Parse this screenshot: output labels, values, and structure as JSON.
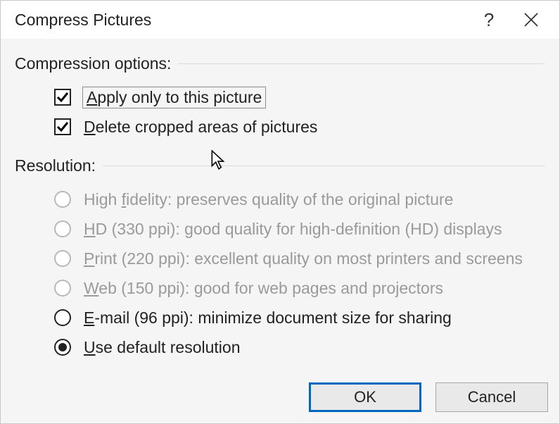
{
  "title": "Compress Pictures",
  "groups": {
    "compression": {
      "header": "Compression options:",
      "apply_only": {
        "label_pre": "",
        "accel": "A",
        "label_post": "pply only to this picture",
        "checked": true,
        "focused": true
      },
      "delete_cropped": {
        "accel": "D",
        "label_post": "elete cropped areas of pictures",
        "checked": true
      }
    },
    "resolution": {
      "header": "Resolution:",
      "options": [
        {
          "accel": "f",
          "pre": "High ",
          "post": "idelity: preserves quality of the original picture",
          "enabled": false,
          "selected": false
        },
        {
          "accel": "H",
          "pre": "",
          "post": "D (330 ppi): good quality for high-definition (HD) displays",
          "enabled": false,
          "selected": false
        },
        {
          "accel": "P",
          "pre": "",
          "post": "rint (220 ppi): excellent quality on most printers and screens",
          "enabled": false,
          "selected": false
        },
        {
          "accel": "W",
          "pre": "",
          "post": "eb (150 ppi): good for web pages and projectors",
          "enabled": false,
          "selected": false
        },
        {
          "accel": "E",
          "pre": "",
          "post": "-mail (96 ppi): minimize document size for sharing",
          "enabled": true,
          "selected": false
        },
        {
          "accel": "U",
          "pre": "",
          "post": "se default resolution",
          "enabled": true,
          "selected": true
        }
      ]
    }
  },
  "buttons": {
    "ok": "OK",
    "cancel": "Cancel"
  }
}
